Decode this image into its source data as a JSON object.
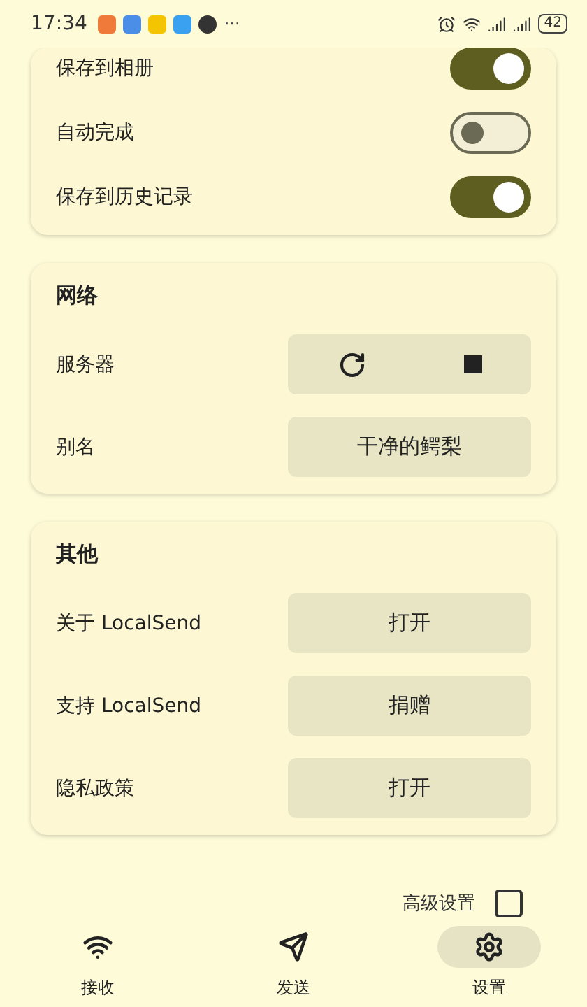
{
  "status_bar": {
    "time": "17:34",
    "more": "···",
    "battery": "42"
  },
  "sections": [
    {
      "rows": [
        {
          "kind": "switch",
          "label": "保存到相册",
          "on": true
        },
        {
          "kind": "switch",
          "label": "自动完成",
          "on": false
        },
        {
          "kind": "switch",
          "label": "保存到历史记录",
          "on": true
        }
      ]
    },
    {
      "title": "网络",
      "rows": [
        {
          "kind": "actions",
          "label": "服务器"
        },
        {
          "kind": "button",
          "label": "别名",
          "button": "干净的鳄梨"
        }
      ]
    },
    {
      "title": "其他",
      "rows": [
        {
          "kind": "button",
          "label": "关于 LocalSend",
          "button": "打开"
        },
        {
          "kind": "button",
          "label": "支持 LocalSend",
          "button": "捐赠"
        },
        {
          "kind": "button",
          "label": "隐私政策",
          "button": "打开"
        }
      ]
    }
  ],
  "advanced": {
    "label": "高级设置",
    "checked": false
  },
  "nav": [
    {
      "label": "接收",
      "selected": false
    },
    {
      "label": "发送",
      "selected": false
    },
    {
      "label": "设置",
      "selected": true
    }
  ]
}
